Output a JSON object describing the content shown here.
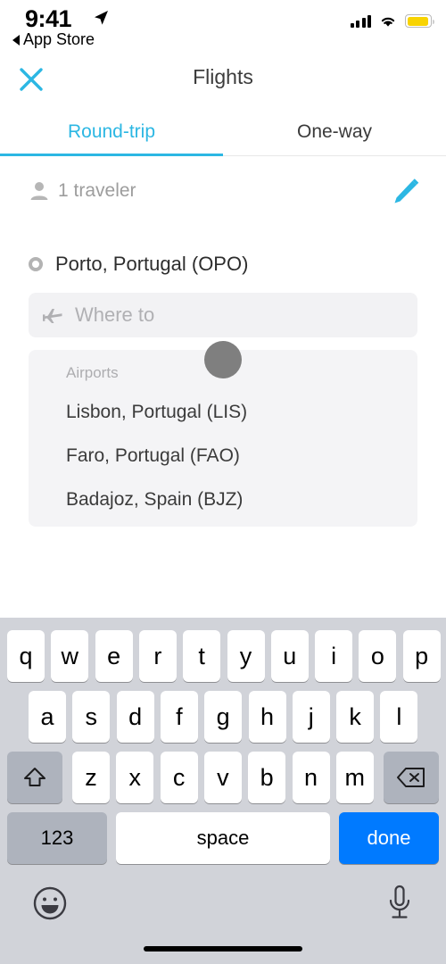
{
  "status_bar": {
    "time": "9:41",
    "location_icon": "location-arrow-icon",
    "back_label": "App Store",
    "signal_icon": "cellular-signal-icon",
    "wifi_icon": "wifi-icon",
    "battery_icon": "battery-icon",
    "battery_color": "#f8d302"
  },
  "nav": {
    "title": "Flights",
    "close_icon": "close-icon",
    "accent_color": "#2cb7e3"
  },
  "tabs": {
    "items": [
      {
        "label": "Round-trip",
        "active": true
      },
      {
        "label": "One-way",
        "active": false
      }
    ]
  },
  "traveler": {
    "icon": "person-icon",
    "label": "1 traveler",
    "edit_icon": "pencil-edit-icon"
  },
  "search": {
    "origin": {
      "icon": "circle-outline-icon",
      "value": "Porto, Portugal (OPO)"
    },
    "destination": {
      "icon": "airplane-icon",
      "value": "",
      "placeholder": "Where to"
    }
  },
  "suggestions": {
    "header": "Airports",
    "items": [
      "Lisbon, Portugal (LIS)",
      "Faro, Portugal (FAO)",
      "Badajoz, Spain (BJZ)"
    ]
  },
  "touch_indicator": {
    "name": "touch-point"
  },
  "keyboard": {
    "row1": [
      "q",
      "w",
      "e",
      "r",
      "t",
      "y",
      "u",
      "i",
      "o",
      "p"
    ],
    "row2": [
      "a",
      "s",
      "d",
      "f",
      "g",
      "h",
      "j",
      "k",
      "l"
    ],
    "row3": [
      "z",
      "x",
      "c",
      "v",
      "b",
      "n",
      "m"
    ],
    "shift_icon": "shift-icon",
    "backspace_icon": "backspace-icon",
    "numeric_label": "123",
    "space_label": "space",
    "return_label": "done",
    "return_color": "#007aff",
    "emoji_icon": "emoji-icon",
    "mic_icon": "microphone-icon"
  }
}
